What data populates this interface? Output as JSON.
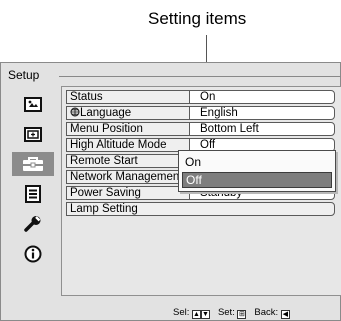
{
  "callout": {
    "label": "Setting items"
  },
  "window": {
    "tab_label": "Setup"
  },
  "sidebar": {
    "items": [
      {
        "icon": "picture-icon"
      },
      {
        "icon": "screen-icon"
      },
      {
        "icon": "setup-toolbox-icon",
        "active": true
      },
      {
        "icon": "menu-list-icon"
      },
      {
        "icon": "wrench-icon"
      },
      {
        "icon": "info-icon"
      }
    ]
  },
  "settings": [
    {
      "label": "Status",
      "value": "On"
    },
    {
      "label": "Language",
      "value": "English",
      "icon": "globe-icon"
    },
    {
      "label": "Menu Position",
      "value": "Bottom Left"
    },
    {
      "label": "High Altitude Mode",
      "value": "Off"
    },
    {
      "label": "Remote Start",
      "value": ""
    },
    {
      "label": "Network Management",
      "value": ""
    },
    {
      "label": "Power Saving",
      "value": "Standby"
    },
    {
      "label": "Lamp Setting"
    }
  ],
  "popup": {
    "options": [
      "On",
      "Off"
    ],
    "selected": "Off"
  },
  "statusbar": {
    "sel_label": "Sel:",
    "set_label": "Set:",
    "back_label": "Back:"
  }
}
